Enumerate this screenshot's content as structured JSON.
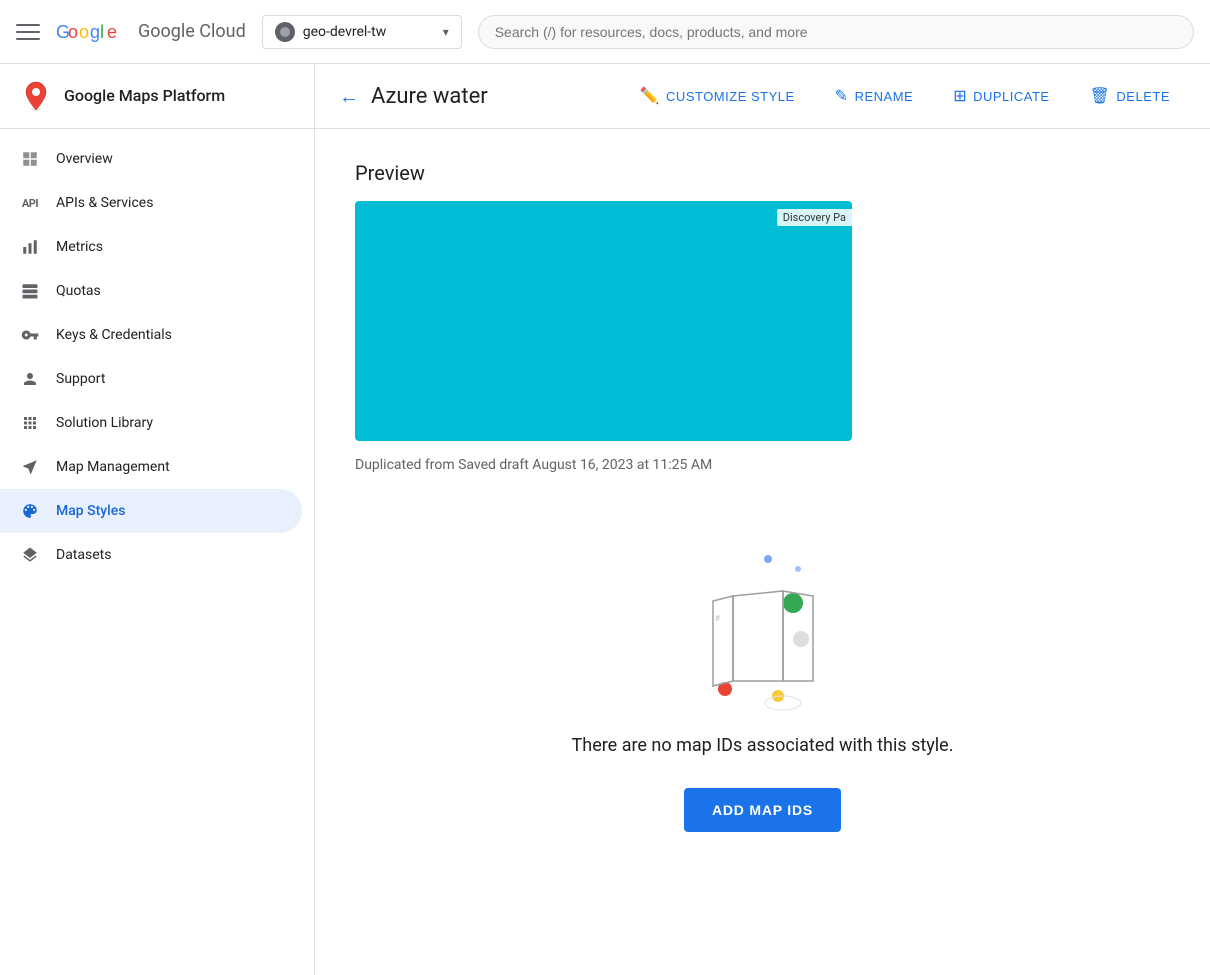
{
  "topbar": {
    "menu_icon_label": "Menu",
    "logo_text": "Google Cloud",
    "project_name": "geo-devrel-tw",
    "search_placeholder": "Search (/) for resources, docs, products, and more"
  },
  "sidebar": {
    "brand_text": "Google Maps Platform",
    "nav_items": [
      {
        "id": "overview",
        "label": "Overview",
        "icon": "grid-icon"
      },
      {
        "id": "apis",
        "label": "APIs & Services",
        "icon": "api-icon"
      },
      {
        "id": "metrics",
        "label": "Metrics",
        "icon": "bar-chart-icon"
      },
      {
        "id": "quotas",
        "label": "Quotas",
        "icon": "storage-icon"
      },
      {
        "id": "keys",
        "label": "Keys & Credentials",
        "icon": "key-icon"
      },
      {
        "id": "support",
        "label": "Support",
        "icon": "person-icon"
      },
      {
        "id": "solution-library",
        "label": "Solution Library",
        "icon": "apps-icon"
      },
      {
        "id": "map-management",
        "label": "Map Management",
        "icon": "map-book-icon"
      },
      {
        "id": "map-styles",
        "label": "Map Styles",
        "icon": "palette-icon",
        "active": true
      },
      {
        "id": "datasets",
        "label": "Datasets",
        "icon": "layers-icon"
      }
    ]
  },
  "subheader": {
    "title": "Azure water",
    "customize_style_label": "CUSTOMIZE STYLE",
    "rename_label": "RENAME",
    "duplicate_label": "DUPLICATE",
    "delete_label": "DELETE"
  },
  "content": {
    "preview_label": "Preview",
    "map_label": "Discovery Pa",
    "duplicate_info": "Duplicated from Saved draft August 16, 2023 at 11:25 AM",
    "no_map_ids_text": "There are no map IDs associated with this style.",
    "add_map_ids_label": "ADD MAP IDS"
  },
  "colors": {
    "accent": "#1a73e8",
    "map_water": "#00bcd4",
    "active_nav": "#e8f0fe",
    "active_text": "#1967d2"
  }
}
